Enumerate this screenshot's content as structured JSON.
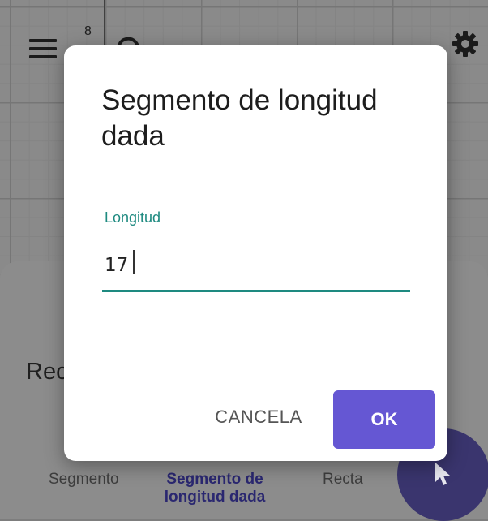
{
  "graph": {
    "axis_tick_label": "8"
  },
  "toolbar": {
    "menu_icon": "hamburger-menu-icon",
    "undo_icon": "undo-icon",
    "settings_icon": "gear-icon"
  },
  "bottom_sheet": {
    "title": "Rec",
    "tools": [
      {
        "label": "Segmento",
        "selected": false
      },
      {
        "label": "Segmento de longitud dada",
        "selected": true
      },
      {
        "label": "Recta",
        "selected": false
      }
    ],
    "fab_icon": "cursor-arrow-icon"
  },
  "dialog": {
    "title": "Segmento de longitud dada",
    "field": {
      "label": "Longitud",
      "value": "17"
    },
    "buttons": {
      "cancel": "CANCELA",
      "ok": "OK"
    }
  },
  "colors": {
    "accent_teal": "#1e8a80",
    "ok_button": "#6557d3",
    "selected_tool": "#2a2770"
  }
}
